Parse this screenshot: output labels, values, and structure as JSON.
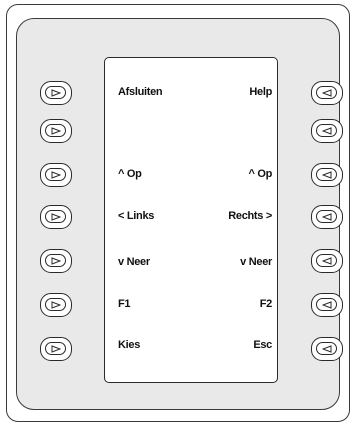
{
  "softkey_rows": [
    {
      "left_label": "Afsluiten",
      "right_label": "Help"
    },
    {
      "left_label": "",
      "right_label": ""
    },
    {
      "left_label": "^ Op",
      "right_label": "^ Op"
    },
    {
      "left_label": "< Links",
      "right_label": "Rechts >"
    },
    {
      "left_label": "v Neer",
      "right_label": "v Neer"
    },
    {
      "left_label": "F1",
      "right_label": "F2"
    },
    {
      "left_label": "Kies",
      "right_label": "Esc"
    }
  ],
  "icons": {
    "left_key": "triangle-right-icon",
    "right_key": "triangle-left-icon"
  },
  "colors": {
    "device_body": "#e9e9e9",
    "screen": "#ffffff",
    "outline": "#2a2a2a"
  }
}
